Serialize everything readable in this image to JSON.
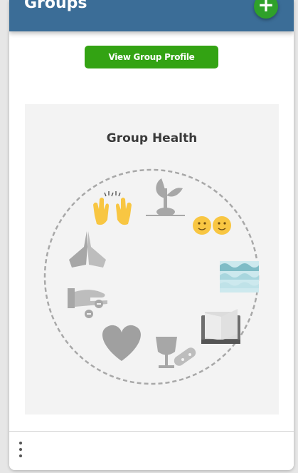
{
  "header": {
    "title": "Groups",
    "add_icon": "plus-icon"
  },
  "actions": {
    "view_profile_label": "View Group Profile"
  },
  "health": {
    "title": "Group Health",
    "icons": [
      "seedling-icon",
      "faces-icon",
      "water-baptism-icon",
      "bible-book-icon",
      "communion-icon",
      "heart-icon",
      "giving-hand-icon",
      "praying-hands-icon",
      "raised-hands-icon"
    ]
  },
  "footer": {
    "menu_icon": "more-vertical-icon"
  },
  "colors": {
    "header": "#3b6d97",
    "accent_green": "#33a313",
    "panel_bg": "#f3f3f3",
    "icon_gray": "#a7a7a7",
    "emoji_yellow": "#f8c642",
    "water_blue": "#8ec9d3"
  }
}
